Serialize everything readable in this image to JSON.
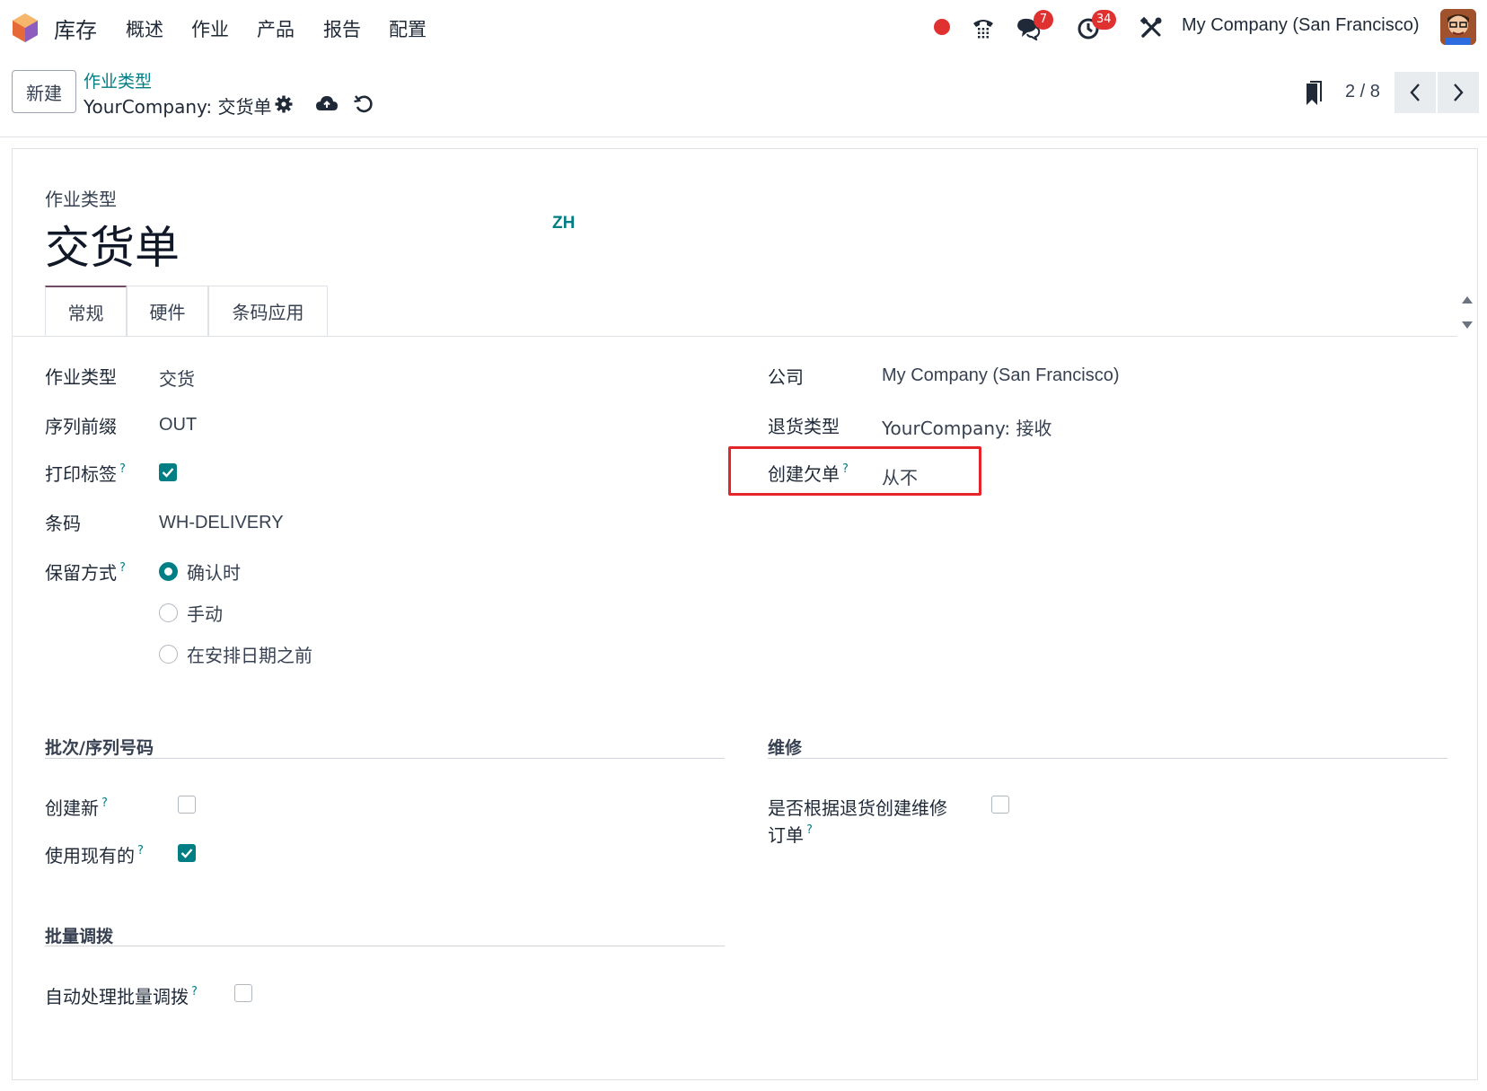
{
  "navbar": {
    "app_name": "库存",
    "menu": [
      "概述",
      "作业",
      "产品",
      "报告",
      "配置"
    ],
    "messages_count": "7",
    "activities_count": "34",
    "company": "My Company (San Francisco)"
  },
  "control_panel": {
    "new_label": "新建",
    "breadcrumb_parent": "作业类型",
    "breadcrumb_current": "YourCompany: 交货单",
    "pager": "2 / 8"
  },
  "form": {
    "kind_label": "作业类型",
    "title": "交货单",
    "lang": "ZH",
    "tabs": [
      "常规",
      "硬件",
      "条码应用"
    ],
    "left_fields": {
      "op_type_label": "作业类型",
      "op_type_value": "交货",
      "prefix_label": "序列前缀",
      "prefix_value": "OUT",
      "print_label_label": "打印标签",
      "print_label_checked": true,
      "barcode_label": "条码",
      "barcode_value": "WH-DELIVERY",
      "reservation_label": "保留方式",
      "reservation_options": [
        "确认时",
        "手动",
        "在安排日期之前"
      ],
      "reservation_selected": "确认时"
    },
    "right_fields": {
      "company_label": "公司",
      "company_value": "My Company (San Francisco)",
      "return_type_label": "退货类型",
      "return_type_value": "YourCompany: 接收",
      "backorder_label": "创建欠单",
      "backorder_value": "从不"
    },
    "lots_section": {
      "title": "批次/序列号码",
      "create_new_label": "创建新",
      "create_new_checked": false,
      "use_existing_label": "使用现有的",
      "use_existing_checked": true
    },
    "repair_section": {
      "title": "维修",
      "repair_label_line1": "是否根据退货创建维修",
      "repair_label_line2": "订单",
      "repair_checked": false
    },
    "batch_section": {
      "title": "批量调拨",
      "auto_batch_label": "自动处理批量调拨",
      "auto_batch_checked": false
    }
  },
  "colors": {
    "accent": "#017e84",
    "brand": "#714b67",
    "badge": "#e03131",
    "highlight": "#e5252a"
  },
  "icons": {
    "logo": "odoo-app-logo",
    "recording": "record-dot-icon",
    "phone": "phone-icon",
    "messages": "chat-icon",
    "activities": "clock-icon",
    "debug": "tools-icon",
    "settings": "gear-icon",
    "save": "cloud-upload-icon",
    "discard": "undo-icon",
    "bookmark": "bookmark-icon",
    "prev": "chevron-left-icon",
    "next": "chevron-right-icon"
  }
}
